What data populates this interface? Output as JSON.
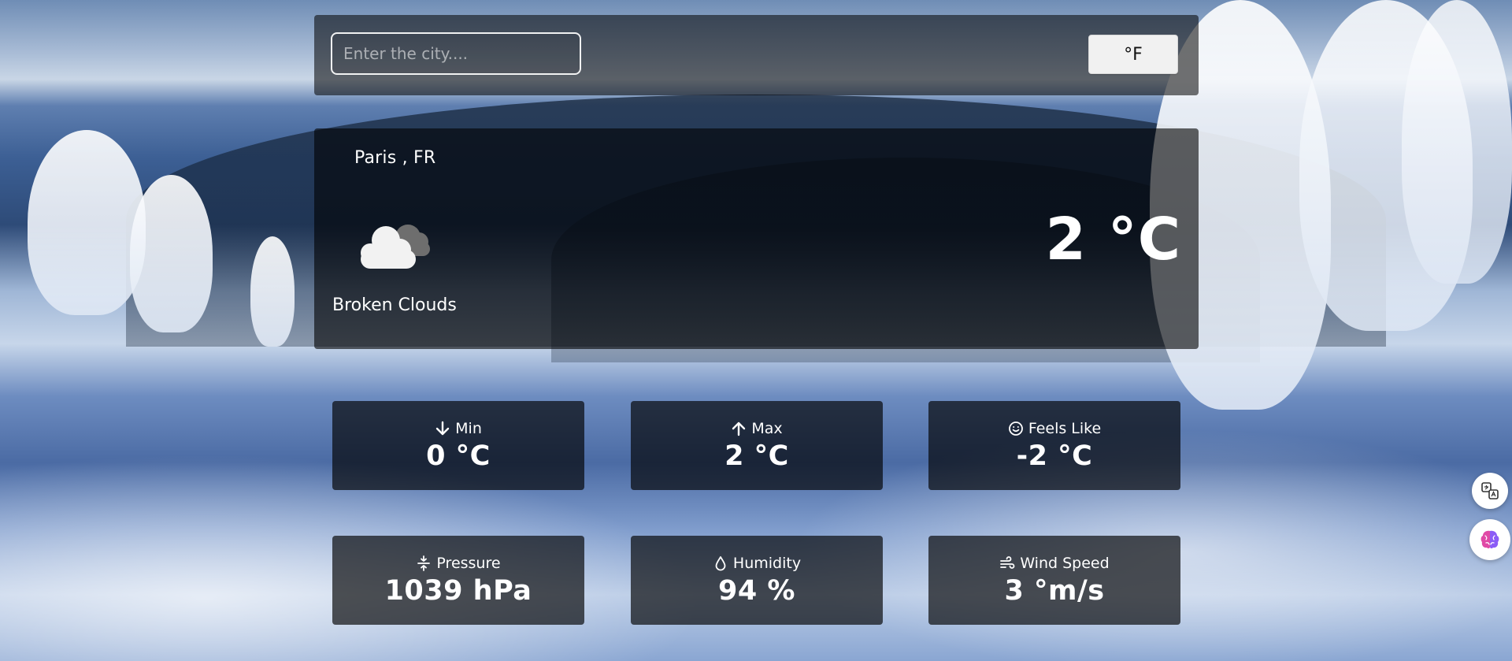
{
  "search": {
    "placeholder": "Enter the city....",
    "unit_toggle_label": "°F"
  },
  "weather": {
    "location": "Paris , FR",
    "icon": "broken-clouds-icon",
    "condition": "Broken Clouds",
    "temperature": "2 °C"
  },
  "stats": {
    "min": {
      "label": "Min",
      "value": "0 °C",
      "icon": "arrow-down-icon"
    },
    "max": {
      "label": "Max",
      "value": "2 °C",
      "icon": "arrow-up-icon"
    },
    "feels_like": {
      "label": "Feels Like",
      "value": "-2 °C",
      "icon": "smile-icon"
    },
    "pressure": {
      "label": "Pressure",
      "value": "1039 hPa",
      "icon": "compress-icon"
    },
    "humidity": {
      "label": "Humidity",
      "value": "94 %",
      "icon": "droplet-icon"
    },
    "wind_speed": {
      "label": "Wind Speed",
      "value": "3 °m/s",
      "icon": "wind-icon"
    }
  },
  "floating_actions": [
    {
      "icon": "translate-icon"
    },
    {
      "icon": "brain-icon"
    }
  ],
  "colors": {
    "panel_bg": "#000000",
    "text": "#ffffff",
    "unit_button_bg": "#f1f1f1"
  }
}
